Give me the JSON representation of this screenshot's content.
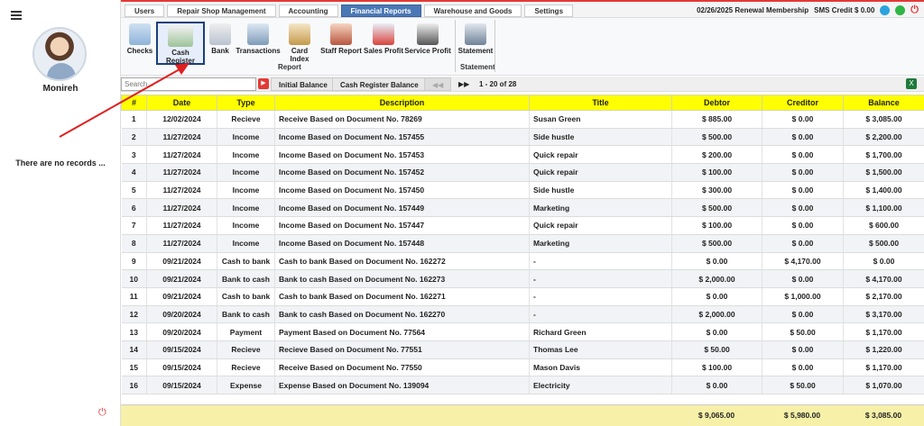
{
  "sidebar": {
    "username": "Monireh",
    "no_records": "There are no records ..."
  },
  "topnav": {
    "tabs": [
      "Users",
      "Repair Shop Management",
      "Accounting",
      "Financial Reports",
      "Warehouse and Goods",
      "Settings"
    ],
    "active_tab": "Financial Reports",
    "renewal": "02/26/2025 Renewal Membership",
    "sms_credit": "SMS Credit $ 0.00"
  },
  "ribbon": {
    "buttons": [
      "Checks",
      "Cash Register",
      "Bank",
      "Transactions",
      "Card Index",
      "Staff Report",
      "Sales Profit",
      "Service Profit",
      "Statement"
    ],
    "selected": "Cash Register",
    "group_report": "Report",
    "group_statement": "Statement"
  },
  "toolbar": {
    "search_placeholder": "Search...",
    "initial_balance": "Initial Balance",
    "cash_register_balance": "Cash Register Balance",
    "prev": "◀◀",
    "next": "▶▶",
    "pager": "1 - 20 of 28"
  },
  "table": {
    "headers": [
      "#",
      "Date",
      "Type",
      "Description",
      "Title",
      "Debtor",
      "Creditor",
      "Balance"
    ],
    "rows": [
      [
        "1",
        "12/02/2024",
        "Recieve",
        "Receive Based on Document No. 78269",
        "Susan Green",
        "$ 885.00",
        "$ 0.00",
        "$ 3,085.00"
      ],
      [
        "2",
        "11/27/2024",
        "Income",
        "Income Based on Document No. 157455",
        "Side hustle",
        "$ 500.00",
        "$ 0.00",
        "$ 2,200.00"
      ],
      [
        "3",
        "11/27/2024",
        "Income",
        "Income Based on Document No. 157453",
        "Quick repair",
        "$ 200.00",
        "$ 0.00",
        "$ 1,700.00"
      ],
      [
        "4",
        "11/27/2024",
        "Income",
        "Income Based on Document No. 157452",
        "Quick repair",
        "$ 100.00",
        "$ 0.00",
        "$ 1,500.00"
      ],
      [
        "5",
        "11/27/2024",
        "Income",
        "Income Based on Document No. 157450",
        "Side hustle",
        "$ 300.00",
        "$ 0.00",
        "$ 1,400.00"
      ],
      [
        "6",
        "11/27/2024",
        "Income",
        "Income Based on Document No. 157449",
        "Marketing",
        "$ 500.00",
        "$ 0.00",
        "$ 1,100.00"
      ],
      [
        "7",
        "11/27/2024",
        "Income",
        "Income Based on Document No. 157447",
        "Quick repair",
        "$ 100.00",
        "$ 0.00",
        "$ 600.00"
      ],
      [
        "8",
        "11/27/2024",
        "Income",
        "Income Based on Document No. 157448",
        "Marketing",
        "$ 500.00",
        "$ 0.00",
        "$ 500.00"
      ],
      [
        "9",
        "09/21/2024",
        "Cash to bank",
        "Cash to bank Based on Document No. 162272",
        "-",
        "$ 0.00",
        "$ 4,170.00",
        "$ 0.00"
      ],
      [
        "10",
        "09/21/2024",
        "Bank to cash",
        "Bank to cash Based on Document No. 162273",
        "-",
        "$ 2,000.00",
        "$ 0.00",
        "$ 4,170.00"
      ],
      [
        "11",
        "09/21/2024",
        "Cash to bank",
        "Cash to bank Based on Document No. 162271",
        "-",
        "$ 0.00",
        "$ 1,000.00",
        "$ 2,170.00"
      ],
      [
        "12",
        "09/20/2024",
        "Bank to cash",
        "Bank to cash Based on Document No. 162270",
        "-",
        "$ 2,000.00",
        "$ 0.00",
        "$ 3,170.00"
      ],
      [
        "13",
        "09/20/2024",
        "Payment",
        "Payment Based on Document No. 77564",
        "Richard Green",
        "$ 0.00",
        "$ 50.00",
        "$ 1,170.00"
      ],
      [
        "14",
        "09/15/2024",
        "Recieve",
        "Recieve Based on Document No. 77551",
        "Thomas Lee",
        "$ 50.00",
        "$ 0.00",
        "$ 1,220.00"
      ],
      [
        "15",
        "09/15/2024",
        "Recieve",
        "Receive Based on Document No. 77550",
        "Mason Davis",
        "$ 100.00",
        "$ 0.00",
        "$ 1,170.00"
      ],
      [
        "16",
        "09/15/2024",
        "Expense",
        "Expense Based on Document No. 139094",
        "Electricity",
        "$ 0.00",
        "$ 50.00",
        "$ 1,070.00"
      ]
    ],
    "totals": {
      "debtor": "$ 9,065.00",
      "creditor": "$ 5,980.00",
      "balance": "$ 3,085.00"
    }
  }
}
